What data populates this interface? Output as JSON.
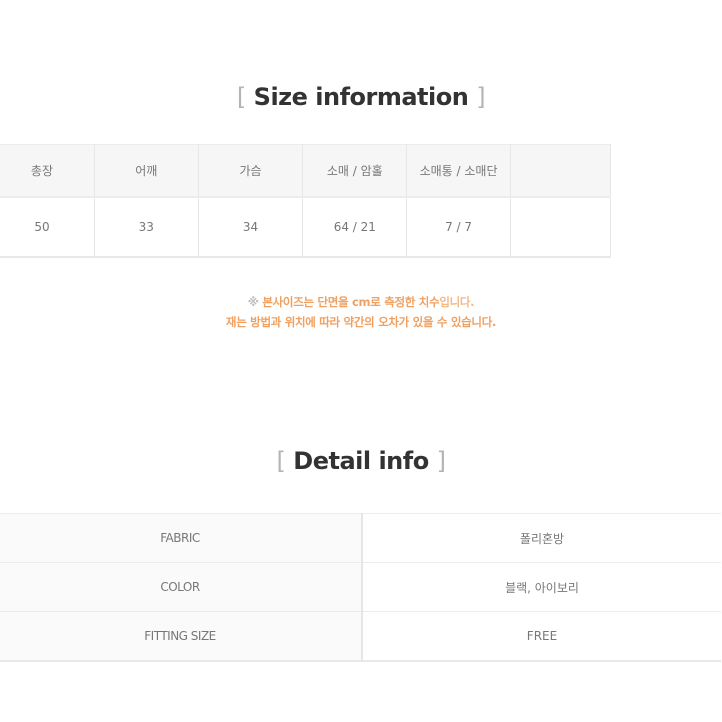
{
  "size_section": {
    "title_open": "[",
    "title": "Size information",
    "title_close": "]",
    "headers": [
      "",
      "총장",
      "어깨",
      "가슴",
      "소매 / 암홀",
      "소매통 / 소매단",
      ""
    ],
    "values": [
      "",
      "50",
      "33",
      "34",
      "64 / 21",
      "7 / 7",
      ""
    ]
  },
  "note": {
    "mark": "※",
    "line1_main": "본사이즈는 단면을 cm로 측정한 치수",
    "line1_tail": "입니다.",
    "line2": "재는 방법과 위치에 따라 약간의 오차가 있을 수 있습니다."
  },
  "detail_section": {
    "title_open": "[",
    "title": "Detail info",
    "title_close": "]",
    "rows": [
      {
        "label": "FABRIC",
        "value": "폴리혼방"
      },
      {
        "label": "COLOR",
        "value": "블랙, 아이보리"
      },
      {
        "label": "FITTING SIZE",
        "value": "FREE"
      }
    ]
  },
  "colors": {
    "note_orange": "#f0a060",
    "title_text": "#333333",
    "bracket": "#b4b4b4",
    "header_bg": "#f6f6f6"
  }
}
